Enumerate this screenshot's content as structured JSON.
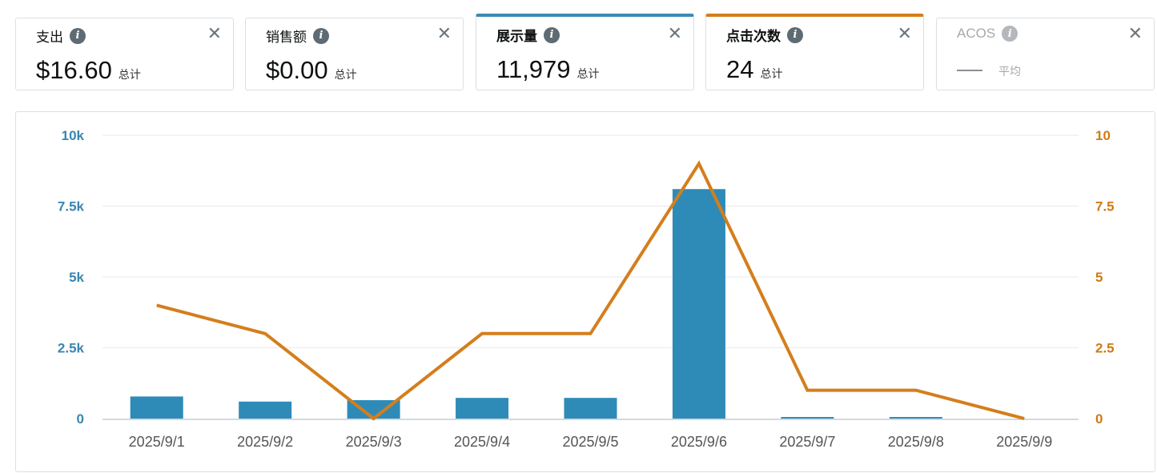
{
  "metrics": [
    {
      "label": "支出",
      "value": "$16.60",
      "unit": "总计"
    },
    {
      "label": "销售额",
      "value": "$0.00",
      "unit": "总计"
    },
    {
      "label": "展示量",
      "value": "11,979",
      "unit": "总计"
    },
    {
      "label": "点击次数",
      "value": "24",
      "unit": "总计"
    },
    {
      "label": "ACOS",
      "value": "",
      "unit": "平均"
    }
  ],
  "icons": {
    "info": "info-icon",
    "close": "close-icon"
  },
  "colors": {
    "impressions": "#2e8bb8",
    "clicks": "#d47e1c",
    "left_axis": "#3a86b0",
    "right_axis": "#d07a14"
  },
  "chart_data": {
    "type": "bar",
    "categories": [
      "2025/9/1",
      "2025/9/2",
      "2025/9/3",
      "2025/9/4",
      "2025/9/5",
      "2025/9/6",
      "2025/9/7",
      "2025/9/8",
      "2025/9/9"
    ],
    "series": [
      {
        "name": "展示量",
        "type": "bar",
        "axis": "left",
        "values": [
          780,
          600,
          650,
          730,
          730,
          8100,
          50,
          50,
          0
        ]
      },
      {
        "name": "点击次数",
        "type": "line",
        "axis": "right",
        "values": [
          4,
          3,
          0,
          3,
          3,
          9,
          1,
          1,
          0
        ]
      }
    ],
    "left_ticks": [
      "0",
      "2.5k",
      "5k",
      "7.5k",
      "10k"
    ],
    "right_ticks": [
      "0",
      "2.5",
      "5",
      "7.5",
      "10"
    ],
    "ylim_left": [
      0,
      10000
    ],
    "ylim_right": [
      0,
      10
    ],
    "grid": true
  }
}
